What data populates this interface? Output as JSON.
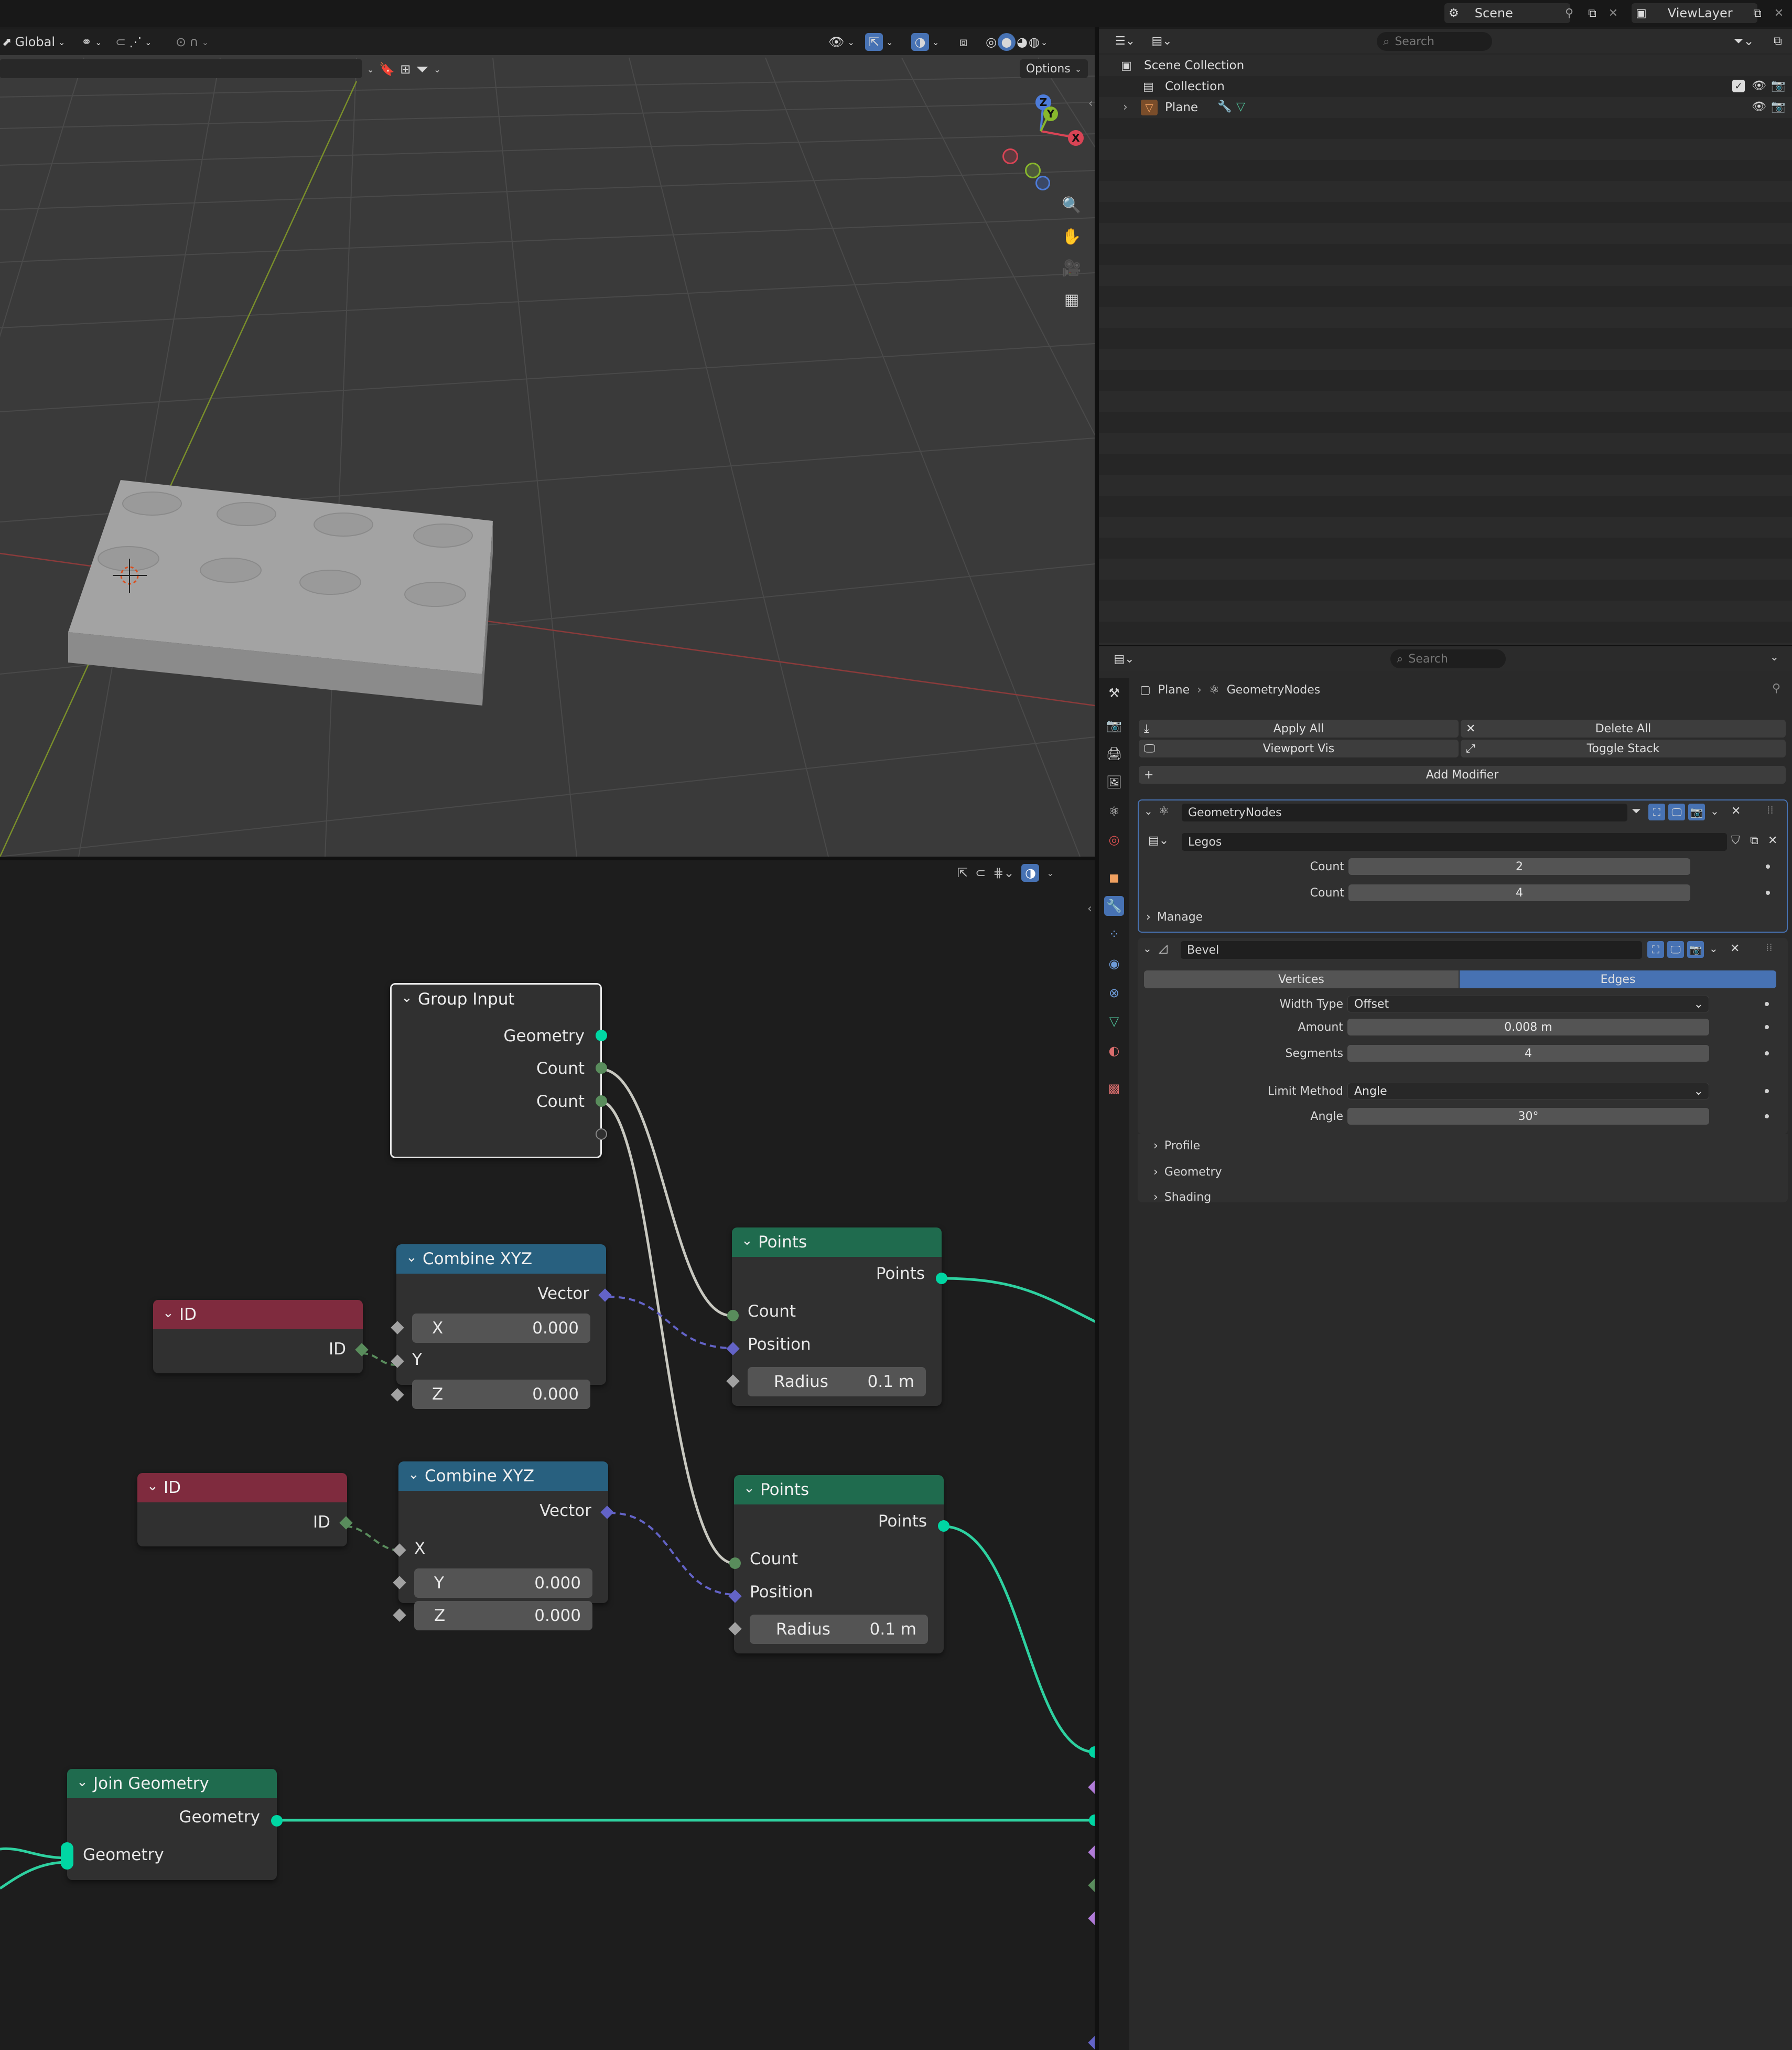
{
  "top_bar": {
    "scene": "Scene",
    "view_layer": "ViewLayer"
  },
  "viewport": {
    "transform_orientation": "Global",
    "options_label": "Options",
    "gizmo_axes": {
      "x": "X",
      "y": "Y",
      "z": "Z"
    }
  },
  "outliner": {
    "search_placeholder": "Search",
    "scene_collection": "Scene Collection",
    "collection": "Collection",
    "object": "Plane"
  },
  "properties": {
    "search_placeholder": "Search",
    "breadcrumb": {
      "object": "Plane",
      "modifier": "GeometryNodes"
    },
    "apply_all": "Apply All",
    "delete_all": "Delete All",
    "viewport_vis": "Viewport Vis",
    "toggle_stack": "Toggle Stack",
    "add_modifier": "Add Modifier",
    "geometry_nodes": {
      "name": "GeometryNodes",
      "node_group": "Legos",
      "inputs": [
        {
          "label": "Count",
          "value": "2"
        },
        {
          "label": "Count",
          "value": "4"
        }
      ],
      "manage": "Manage"
    },
    "bevel": {
      "name": "Bevel",
      "affect_options": [
        "Vertices",
        "Edges"
      ],
      "affect_selected": "Edges",
      "width_type_label": "Width Type",
      "width_type": "Offset",
      "amount_label": "Amount",
      "amount": "0.008 m",
      "segments_label": "Segments",
      "segments": "4",
      "limit_method_label": "Limit Method",
      "limit_method": "Angle",
      "angle_label": "Angle",
      "angle": "30°",
      "panels": [
        "Profile",
        "Geometry",
        "Shading"
      ]
    }
  },
  "nodes": {
    "group_input": {
      "title": "Group Input",
      "outputs": [
        "Geometry",
        "Count",
        "Count"
      ]
    },
    "combine_xyz_1": {
      "title": "Combine XYZ",
      "output": "Vector",
      "x_label": "X",
      "x_value": "0.000",
      "y_label": "Y",
      "z_label": "Z",
      "z_value": "0.000"
    },
    "combine_xyz_2": {
      "title": "Combine XYZ",
      "output": "Vector",
      "x_label": "X",
      "y_label": "Y",
      "y_value": "0.000",
      "z_label": "Z",
      "z_value": "0.000"
    },
    "id_1": {
      "title": "ID",
      "output": "ID"
    },
    "id_2": {
      "title": "ID",
      "output": "ID"
    },
    "points_1": {
      "title": "Points",
      "output": "Points",
      "count": "Count",
      "position": "Position",
      "radius_label": "Radius",
      "radius_value": "0.1 m"
    },
    "points_2": {
      "title": "Points",
      "output": "Points",
      "count": "Count",
      "position": "Position",
      "radius_label": "Radius",
      "radius_value": "0.1 m"
    },
    "join_geometry": {
      "title": "Join Geometry",
      "output": "Geometry",
      "input": "Geometry"
    }
  },
  "colors": {
    "geometry_socket": "#00d6a3",
    "int_socket": "#598c5c",
    "vector_socket": "#6363c7",
    "float_socket": "#a1a1a1",
    "header_blue": "#28607f",
    "header_green": "#1f6b4e",
    "header_red": "#7f2b3e",
    "accent_blue": "#4772b3"
  }
}
